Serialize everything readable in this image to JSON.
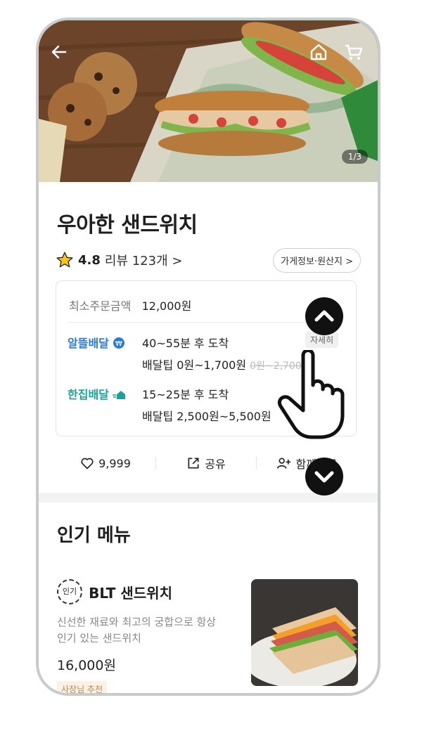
{
  "hero": {
    "image_counter": "1/3",
    "back_icon": "back-arrow-icon",
    "home_icon": "home-icon",
    "cart_icon": "cart-icon"
  },
  "store": {
    "name": "우아한 샌드위치",
    "rating": "4.8",
    "reviews": "리뷰 123개 >",
    "info_button": "가게정보·원산지 >"
  },
  "info": {
    "min_order_label": "최소주문금액",
    "min_order_value": "12,000원",
    "delivery_a": {
      "name": "알뜰배달",
      "time": "40~55분 후 도착",
      "tip": "배달팁 0원~1,700원",
      "old_tip": "0원~2,700원",
      "detail_button": "자세히"
    },
    "delivery_b": {
      "name": "한집배달",
      "time": "15~25분 후 도착",
      "tip": "배달팁 2,500원~5,500원"
    }
  },
  "actions": {
    "like": "9,999",
    "share": "공유",
    "together": "함께주문"
  },
  "popular": {
    "title": "인기 메뉴",
    "item": {
      "badge": "인기",
      "name": "BLT 샌드위치",
      "desc": "신선한 재료와 최고의 궁합으로 항상 인기 있는 샌드위치",
      "price": "16,000원",
      "tag": "사장님 추천"
    }
  },
  "colors": {
    "delivery_a": "#2a7bd8",
    "delivery_b": "#1aa39a",
    "star": "#f5c518"
  }
}
